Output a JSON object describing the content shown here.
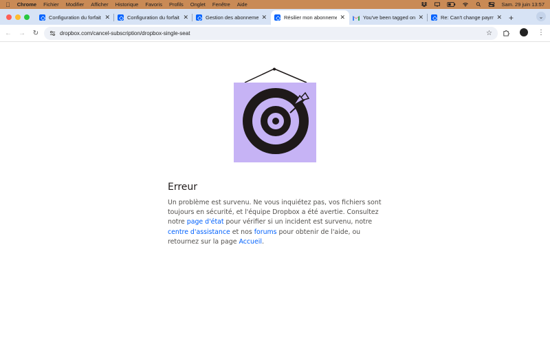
{
  "menubar": {
    "app": "Chrome",
    "items": [
      "Fichier",
      "Modifier",
      "Afficher",
      "Historique",
      "Favoris",
      "Profils",
      "Onglet",
      "Fenêtre",
      "Aide"
    ],
    "datetime": "Sam. 29 juin  13:57"
  },
  "tabs": [
    {
      "title": "Configuration du forfait",
      "icon": "dropbox-icon"
    },
    {
      "title": "Configuration du forfait",
      "icon": "dropbox-icon"
    },
    {
      "title": "Gestion des abonnements",
      "icon": "dropbox-icon"
    },
    {
      "title": "Résilier mon abonnement",
      "icon": "dropbox-icon",
      "active": true
    },
    {
      "title": "You've been tagged on",
      "icon": "gmail-icon"
    },
    {
      "title": "Re: Can't change paym",
      "icon": "dropbox-icon"
    }
  ],
  "address": {
    "url": "dropbox.com/cancel-subscription/dropbox-single-seat"
  },
  "error": {
    "title": "Erreur",
    "text1": "Un problème est survenu. Ne vous inquiétez pas, vos fichiers sont toujours en sécurité, et l'équipe Dropbox a été avertie. Consultez notre ",
    "link_status": "page d'état",
    "text2": " pour vérifier si un incident est survenu, notre ",
    "link_support": "centre d'assistance",
    "text3": " et nos ",
    "link_forums": "forums",
    "text4": " pour obtenir de l'aide, ou retournez sur la page ",
    "link_home": "Accueil",
    "text5": "."
  },
  "colors": {
    "link": "#0061fe",
    "illustration_bg": "#c6b3f5",
    "menubar": "#c98a55",
    "tabstrip": "#d7e3f5"
  }
}
